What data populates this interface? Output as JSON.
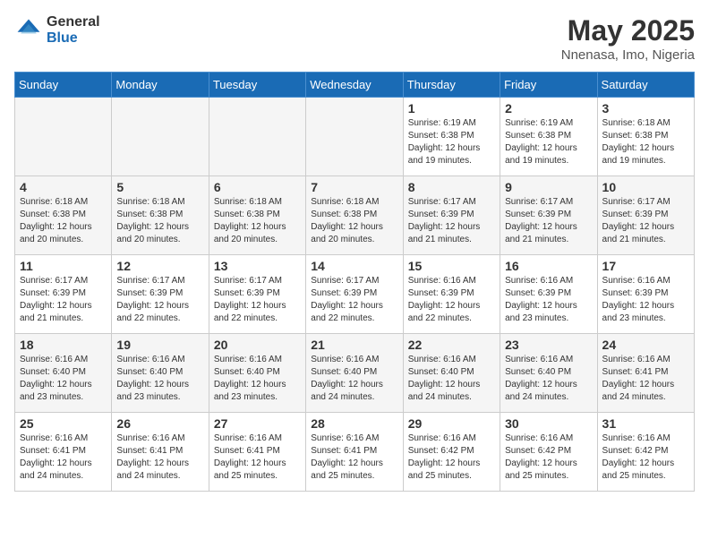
{
  "logo": {
    "general": "General",
    "blue": "Blue"
  },
  "title": "May 2025",
  "location": "Nnenasa, Imo, Nigeria",
  "days_of_week": [
    "Sunday",
    "Monday",
    "Tuesday",
    "Wednesday",
    "Thursday",
    "Friday",
    "Saturday"
  ],
  "weeks": [
    [
      {
        "day": "",
        "empty": true
      },
      {
        "day": "",
        "empty": true
      },
      {
        "day": "",
        "empty": true
      },
      {
        "day": "",
        "empty": true
      },
      {
        "day": "1",
        "sunrise": "6:19 AM",
        "sunset": "6:38 PM",
        "daylight": "12 hours and 19 minutes."
      },
      {
        "day": "2",
        "sunrise": "6:19 AM",
        "sunset": "6:38 PM",
        "daylight": "12 hours and 19 minutes."
      },
      {
        "day": "3",
        "sunrise": "6:18 AM",
        "sunset": "6:38 PM",
        "daylight": "12 hours and 19 minutes."
      }
    ],
    [
      {
        "day": "4",
        "sunrise": "6:18 AM",
        "sunset": "6:38 PM",
        "daylight": "12 hours and 20 minutes."
      },
      {
        "day": "5",
        "sunrise": "6:18 AM",
        "sunset": "6:38 PM",
        "daylight": "12 hours and 20 minutes."
      },
      {
        "day": "6",
        "sunrise": "6:18 AM",
        "sunset": "6:38 PM",
        "daylight": "12 hours and 20 minutes."
      },
      {
        "day": "7",
        "sunrise": "6:18 AM",
        "sunset": "6:38 PM",
        "daylight": "12 hours and 20 minutes."
      },
      {
        "day": "8",
        "sunrise": "6:17 AM",
        "sunset": "6:39 PM",
        "daylight": "12 hours and 21 minutes."
      },
      {
        "day": "9",
        "sunrise": "6:17 AM",
        "sunset": "6:39 PM",
        "daylight": "12 hours and 21 minutes."
      },
      {
        "day": "10",
        "sunrise": "6:17 AM",
        "sunset": "6:39 PM",
        "daylight": "12 hours and 21 minutes."
      }
    ],
    [
      {
        "day": "11",
        "sunrise": "6:17 AM",
        "sunset": "6:39 PM",
        "daylight": "12 hours and 21 minutes."
      },
      {
        "day": "12",
        "sunrise": "6:17 AM",
        "sunset": "6:39 PM",
        "daylight": "12 hours and 22 minutes."
      },
      {
        "day": "13",
        "sunrise": "6:17 AM",
        "sunset": "6:39 PM",
        "daylight": "12 hours and 22 minutes."
      },
      {
        "day": "14",
        "sunrise": "6:17 AM",
        "sunset": "6:39 PM",
        "daylight": "12 hours and 22 minutes."
      },
      {
        "day": "15",
        "sunrise": "6:16 AM",
        "sunset": "6:39 PM",
        "daylight": "12 hours and 22 minutes."
      },
      {
        "day": "16",
        "sunrise": "6:16 AM",
        "sunset": "6:39 PM",
        "daylight": "12 hours and 23 minutes."
      },
      {
        "day": "17",
        "sunrise": "6:16 AM",
        "sunset": "6:39 PM",
        "daylight": "12 hours and 23 minutes."
      }
    ],
    [
      {
        "day": "18",
        "sunrise": "6:16 AM",
        "sunset": "6:40 PM",
        "daylight": "12 hours and 23 minutes."
      },
      {
        "day": "19",
        "sunrise": "6:16 AM",
        "sunset": "6:40 PM",
        "daylight": "12 hours and 23 minutes."
      },
      {
        "day": "20",
        "sunrise": "6:16 AM",
        "sunset": "6:40 PM",
        "daylight": "12 hours and 23 minutes."
      },
      {
        "day": "21",
        "sunrise": "6:16 AM",
        "sunset": "6:40 PM",
        "daylight": "12 hours and 24 minutes."
      },
      {
        "day": "22",
        "sunrise": "6:16 AM",
        "sunset": "6:40 PM",
        "daylight": "12 hours and 24 minutes."
      },
      {
        "day": "23",
        "sunrise": "6:16 AM",
        "sunset": "6:40 PM",
        "daylight": "12 hours and 24 minutes."
      },
      {
        "day": "24",
        "sunrise": "6:16 AM",
        "sunset": "6:41 PM",
        "daylight": "12 hours and 24 minutes."
      }
    ],
    [
      {
        "day": "25",
        "sunrise": "6:16 AM",
        "sunset": "6:41 PM",
        "daylight": "12 hours and 24 minutes."
      },
      {
        "day": "26",
        "sunrise": "6:16 AM",
        "sunset": "6:41 PM",
        "daylight": "12 hours and 24 minutes."
      },
      {
        "day": "27",
        "sunrise": "6:16 AM",
        "sunset": "6:41 PM",
        "daylight": "12 hours and 25 minutes."
      },
      {
        "day": "28",
        "sunrise": "6:16 AM",
        "sunset": "6:41 PM",
        "daylight": "12 hours and 25 minutes."
      },
      {
        "day": "29",
        "sunrise": "6:16 AM",
        "sunset": "6:42 PM",
        "daylight": "12 hours and 25 minutes."
      },
      {
        "day": "30",
        "sunrise": "6:16 AM",
        "sunset": "6:42 PM",
        "daylight": "12 hours and 25 minutes."
      },
      {
        "day": "31",
        "sunrise": "6:16 AM",
        "sunset": "6:42 PM",
        "daylight": "12 hours and 25 minutes."
      }
    ]
  ],
  "labels": {
    "sunrise_prefix": "Sunrise: ",
    "sunset_prefix": "Sunset: ",
    "daylight_prefix": "Daylight: "
  }
}
